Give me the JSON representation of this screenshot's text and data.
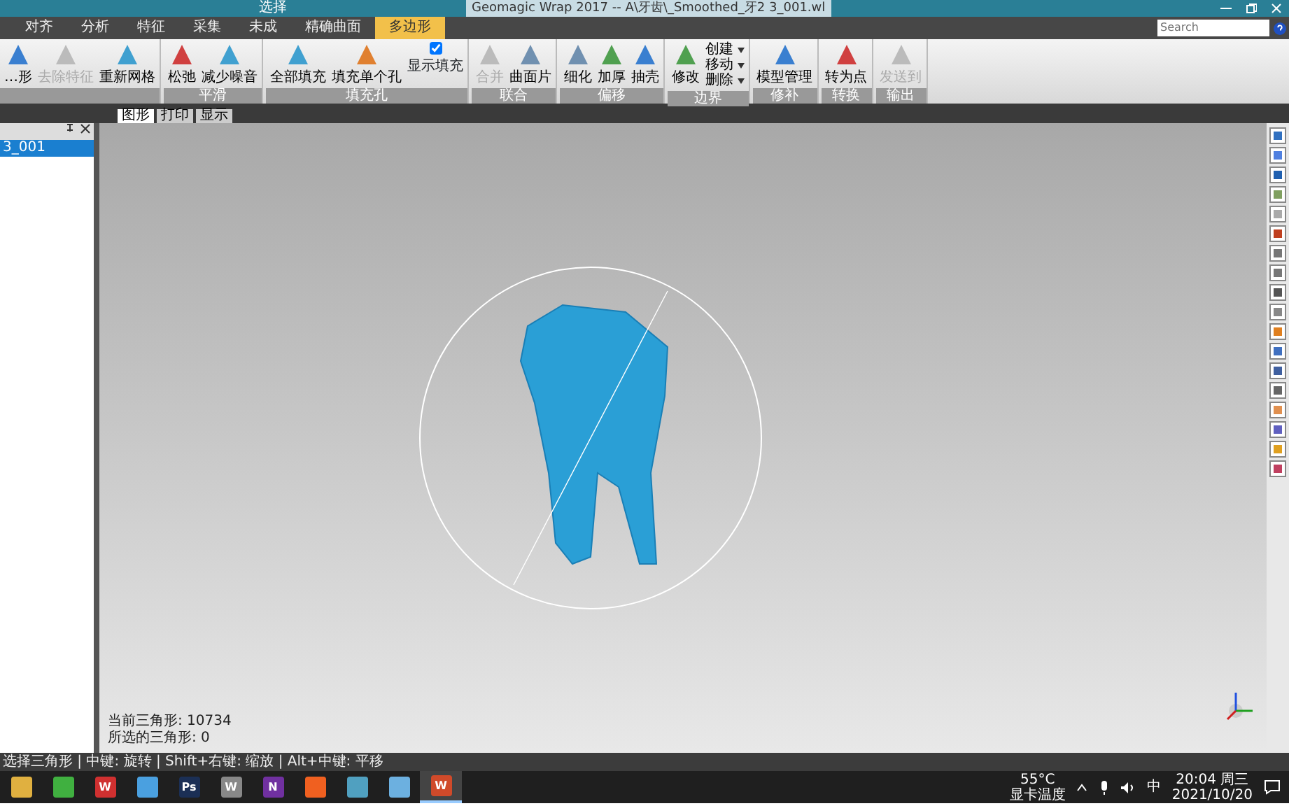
{
  "window": {
    "title": "Geomagic Wrap 2017 -- A\\牙齿\\_Smoothed_牙2 3_001.wl",
    "context_label": "选择"
  },
  "menu_tabs": [
    {
      "label": "对齐",
      "selected": false
    },
    {
      "label": "分析",
      "selected": false
    },
    {
      "label": "特征",
      "selected": false
    },
    {
      "label": "采集",
      "selected": false
    },
    {
      "label": "未成",
      "selected": false
    },
    {
      "label": "精确曲面",
      "selected": false
    },
    {
      "label": "多边形",
      "selected": true
    }
  ],
  "search": {
    "placeholder": "Search"
  },
  "ribbon_groups": [
    {
      "buttons": [
        {
          "label": "…形",
          "disabled": false
        },
        {
          "label": "去除特征",
          "disabled": true
        },
        {
          "label": "重新网格",
          "disabled": false
        }
      ]
    },
    {
      "label": "平滑",
      "buttons": [
        {
          "label": "松弛",
          "disabled": false
        },
        {
          "label": "减少噪音",
          "disabled": false
        }
      ]
    },
    {
      "label": "填充孔",
      "buttons": [
        {
          "label": "全部填充",
          "disabled": false
        },
        {
          "label": "填充单个孔",
          "disabled": false
        }
      ],
      "checkbox": {
        "label": "显示填充",
        "checked": true
      }
    },
    {
      "label": "联合",
      "buttons": [
        {
          "label": "合并",
          "disabled": true
        },
        {
          "label": "曲面片",
          "disabled": false
        }
      ]
    },
    {
      "label": "偏移",
      "buttons": [
        {
          "label": "细化",
          "disabled": false
        },
        {
          "label": "加厚",
          "disabled": false
        },
        {
          "label": "抽壳",
          "disabled": false
        }
      ]
    },
    {
      "label": "边界",
      "menu": [
        "创建",
        "移动",
        "删除"
      ],
      "buttons": [
        {
          "label": "修改",
          "disabled": false
        }
      ]
    },
    {
      "label": "修补",
      "buttons": [
        {
          "label": "模型管理",
          "disabled": false
        }
      ]
    },
    {
      "label": "转换",
      "buttons": [
        {
          "label": "转为点",
          "disabled": false
        }
      ]
    },
    {
      "label": "输出",
      "buttons": [
        {
          "label": "发送到",
          "disabled": true
        }
      ]
    }
  ],
  "panel": {
    "items": [
      {
        "label": "3_001",
        "selected": true
      }
    ]
  },
  "view_tabs": [
    {
      "label": "图形",
      "selected": true
    },
    {
      "label": "打印",
      "selected": false
    },
    {
      "label": "显示",
      "selected": false
    }
  ],
  "viewport": {
    "info": [
      "当前三角形: 10734",
      "所选的三角形: 0"
    ]
  },
  "status_bar": "选择三角形 | 中键: 旋转 | Shift+右键: 缩放 | Alt+中键: 平移",
  "taskbar": {
    "apps": [
      {
        "color": "#e0b040",
        "active": false
      },
      {
        "color": "#40b040",
        "active": false
      },
      {
        "label": "W",
        "color": "#d03030",
        "active": false
      },
      {
        "color": "#4aa0e0",
        "active": false
      },
      {
        "label": "Ps",
        "color": "#1b2f55",
        "active": false
      },
      {
        "label": "W",
        "color": "#888888",
        "active": false
      },
      {
        "label": "N",
        "color": "#7030a0",
        "active": false
      },
      {
        "color": "#f06020",
        "active": false
      },
      {
        "color": "#50a0c0",
        "active": false
      },
      {
        "color": "#6cb0e0",
        "active": false
      },
      {
        "label": "W",
        "color": "#d04a2a",
        "active": true
      }
    ],
    "temperature": "55°C",
    "temperature_label": "显卡温度",
    "ime": "中",
    "time": "20:04 周三",
    "date": "2021/10/20"
  }
}
